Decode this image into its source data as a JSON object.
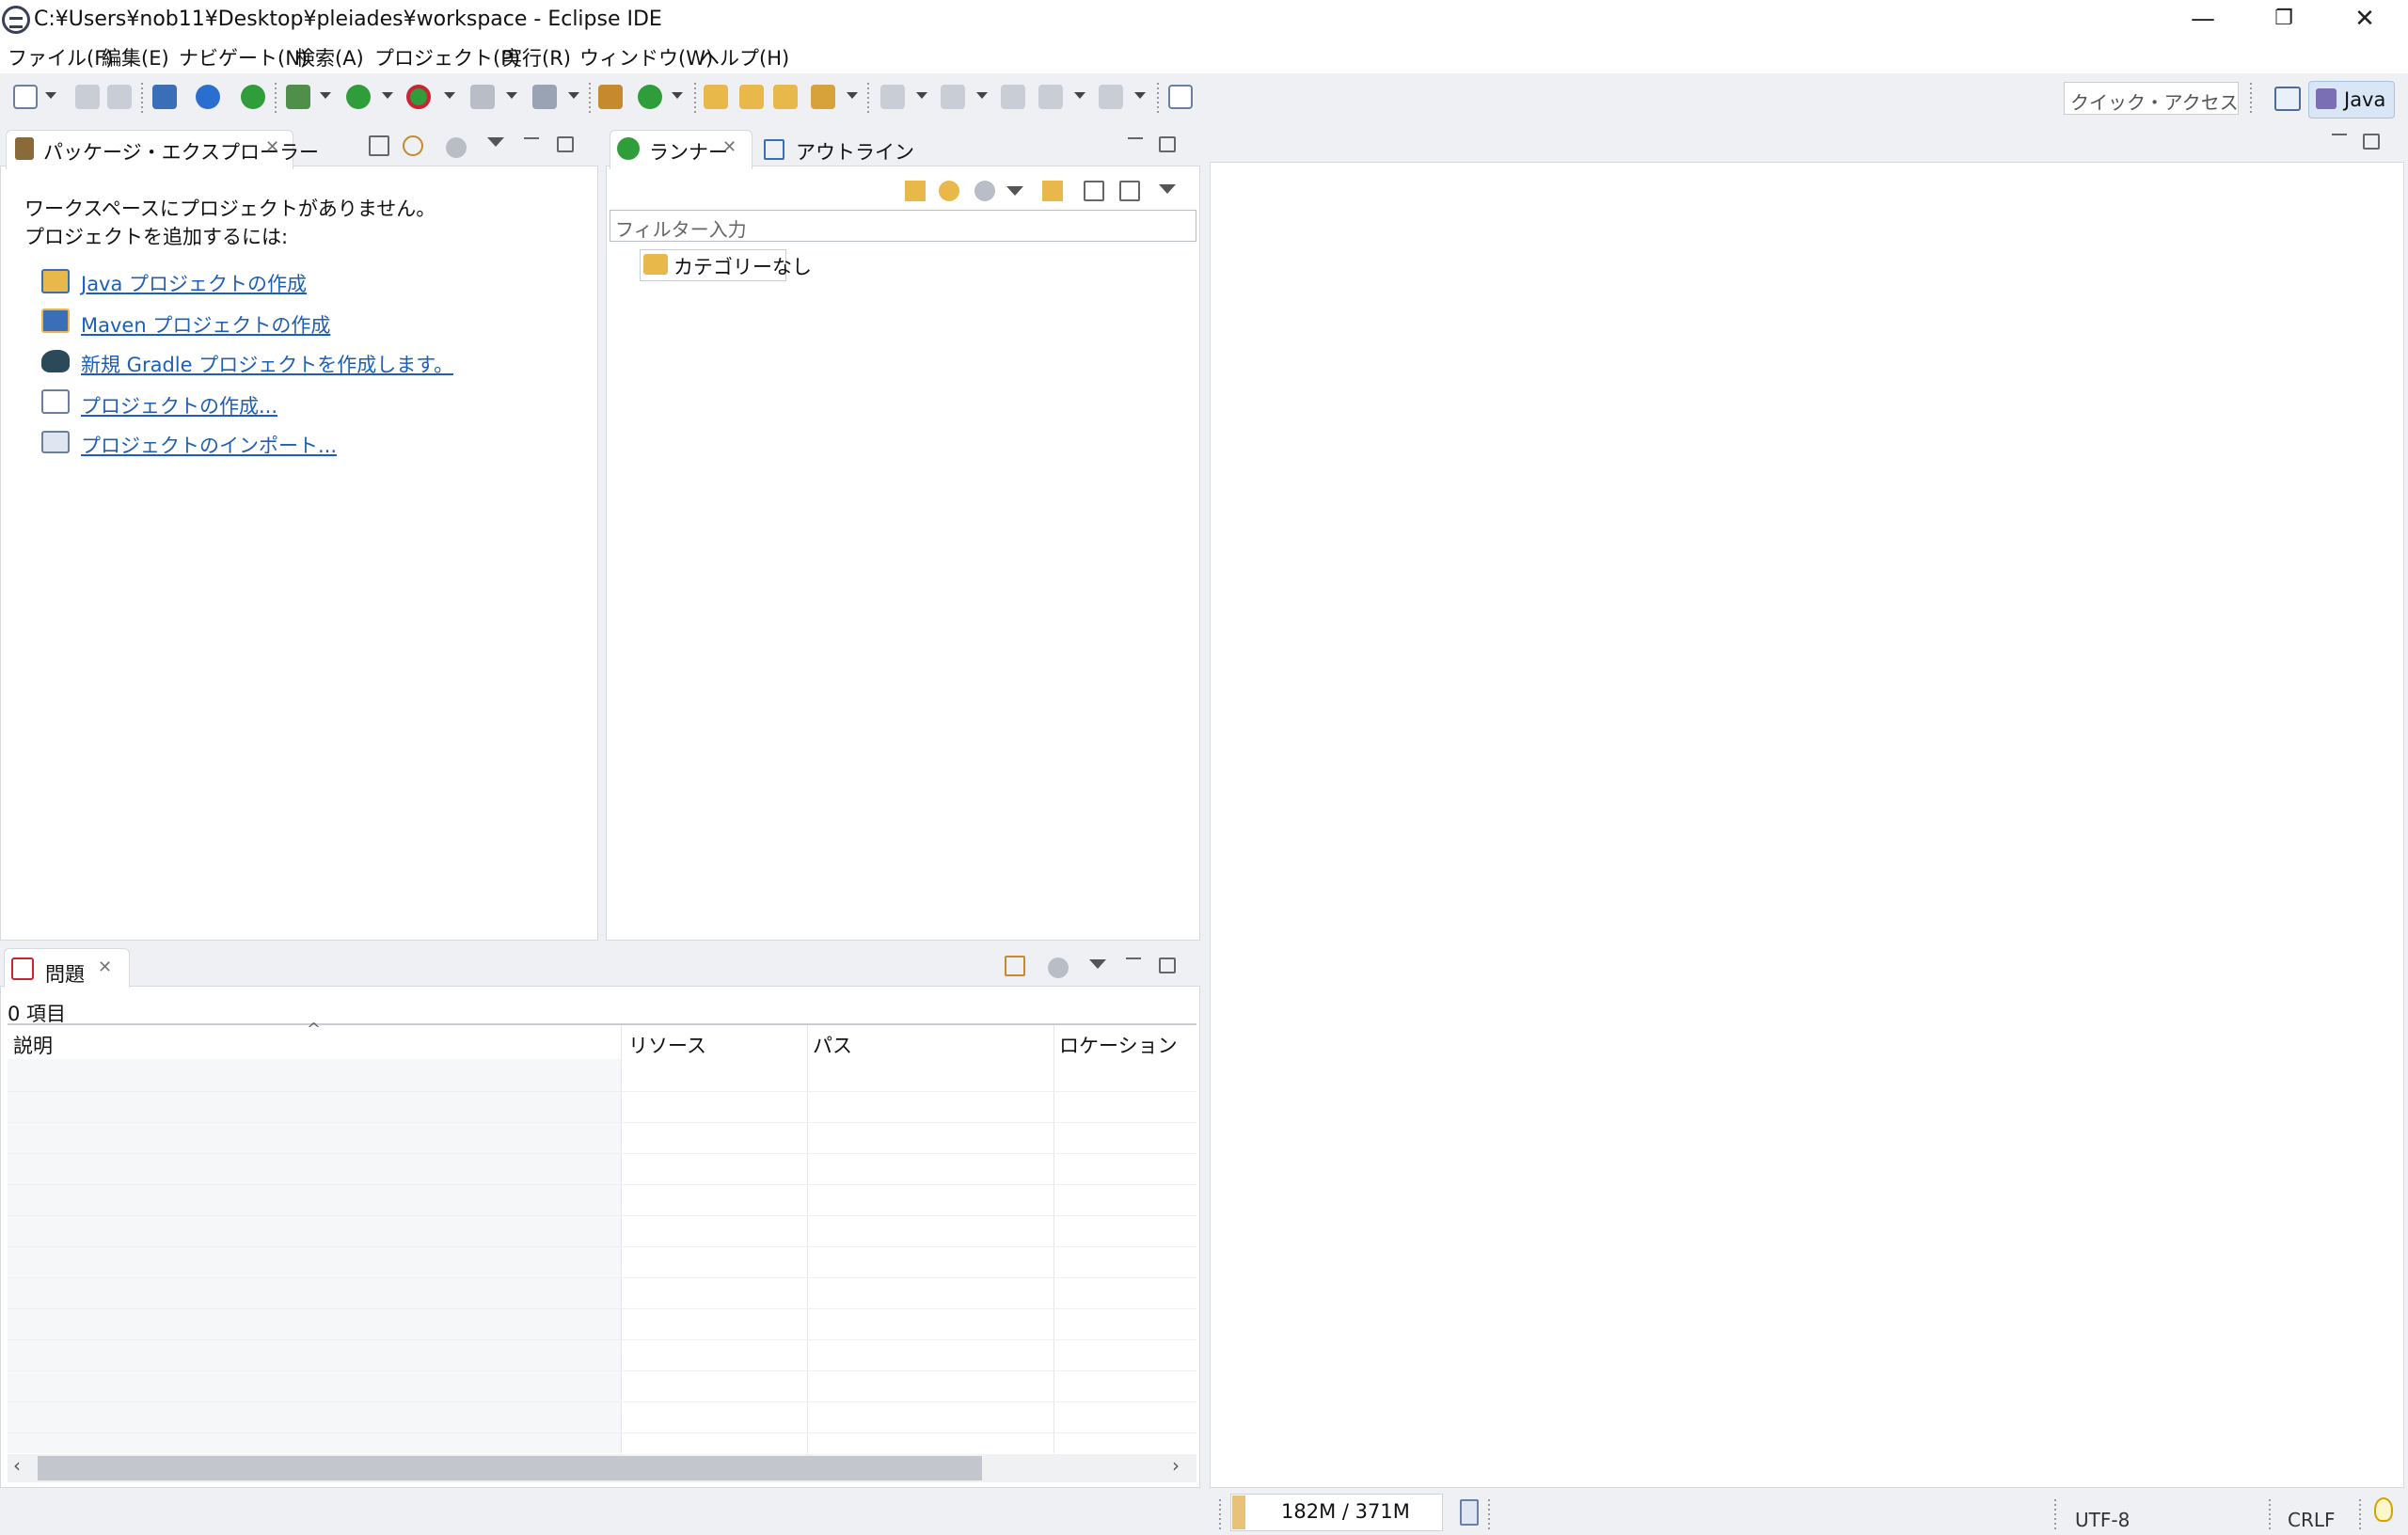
{
  "window": {
    "title": "C:¥Users¥nob11¥Desktop¥pleiades¥workspace - Eclipse IDE",
    "minimize_glyph": "—",
    "restore_glyph": "❐",
    "close_glyph": "✕"
  },
  "menu": [
    "ファイル(F)",
    "編集(E)",
    "ナビゲート(N)",
    "検索(A)",
    "プロジェクト(P)",
    "実行(R)",
    "ウィンドウ(W)",
    "ヘルプ(H)"
  ],
  "toolbar": {
    "quick_access_placeholder": "クイック・アクセス",
    "perspective_label": "Java",
    "icons": [
      "new-icon",
      "save-icon",
      "save-all-icon",
      "terminal-icon",
      "settings-icon",
      "power-icon",
      "debug-icon",
      "run-icon",
      "run-external-icon",
      "stop-icon",
      "new-server-icon",
      "package-icon",
      "refresh-icon",
      "open-type-icon",
      "open-folder-icon",
      "search-icon",
      "next-annotation-icon",
      "prev-annotation-icon",
      "last-edit-icon",
      "back-icon",
      "forward-icon",
      "pin-icon"
    ]
  },
  "package_explorer": {
    "tab_label": "パッケージ・エクスプローラー",
    "message_line1": "ワークスペースにプロジェクトがありません。",
    "message_line2": "プロジェクトを追加するには:",
    "links": [
      {
        "label": "Java プロジェクトの作成",
        "icon": "java-project-icon"
      },
      {
        "label": "Maven プロジェクトの作成",
        "icon": "maven-project-icon"
      },
      {
        "label": "新規 Gradle プロジェクトを作成します。",
        "icon": "gradle-icon"
      },
      {
        "label": "プロジェクトの作成...",
        "icon": "new-project-icon"
      },
      {
        "label": "プロジェクトのインポート...",
        "icon": "import-icon"
      }
    ]
  },
  "runner": {
    "tab_label": "ランナー",
    "outline_tab_label": "アウトライン",
    "filter_placeholder": "フィルター入力",
    "node_label": "カテゴリーなし"
  },
  "problems": {
    "tab_label": "問題",
    "count_label": "0 項目",
    "columns": [
      "説明",
      "リソース",
      "パス",
      "ロケーション"
    ],
    "sort_glyph": "^"
  },
  "status": {
    "heap": "182M / 371M",
    "encoding": "UTF-8",
    "line_delimiter": "CRLF"
  },
  "colors": {
    "accent": "#1d5fb8",
    "run_green": "#2e9d3a",
    "folder_yellow": "#e8b84a",
    "panel_bg": "#ffffff",
    "chrome_bg": "#eef0f3"
  }
}
